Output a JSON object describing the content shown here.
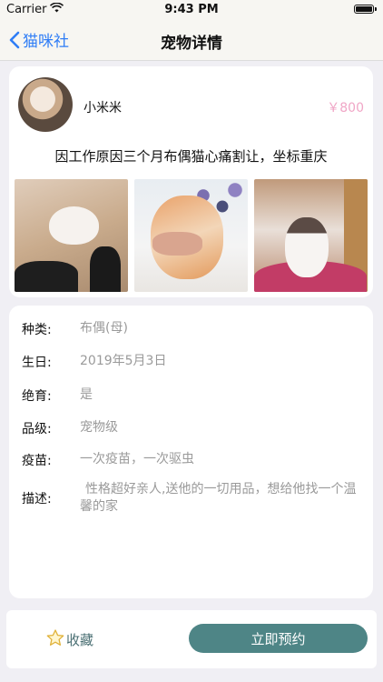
{
  "status": {
    "carrier": "Carrier",
    "time": "9:43 PM"
  },
  "nav": {
    "back_label": "猫咪社",
    "title": "宠物详情"
  },
  "listing": {
    "seller_name": "小米米",
    "price": "￥800",
    "title": "因工作原因三个月布偶猫心痛割让，坐标重庆",
    "photos": [
      "cat-photo-1",
      "cat-photo-2",
      "cat-photo-3"
    ]
  },
  "details": [
    {
      "label": "种类:",
      "value": "布偶(母)"
    },
    {
      "label": "生日:",
      "value": "2019年5月3日"
    },
    {
      "label": "绝育:",
      "value": "是"
    },
    {
      "label": "品级:",
      "value": "宠物级"
    },
    {
      "label": "疫苗:",
      "value": "一次疫苗，一次驱虫"
    },
    {
      "label": "描述:",
      "value": "性格超好亲人,送他的一切用品，想给他找一个温馨的家"
    }
  ],
  "actions": {
    "favorite_label": "收藏",
    "reserve_label": "立即预约"
  },
  "colors": {
    "accent": "#2f7df6",
    "price": "#f0a6c6",
    "primary_button": "#4e8586"
  },
  "icons": {
    "back": "chevron-left-icon",
    "wifi": "wifi-icon",
    "battery": "battery-icon",
    "favorite": "star-icon"
  }
}
